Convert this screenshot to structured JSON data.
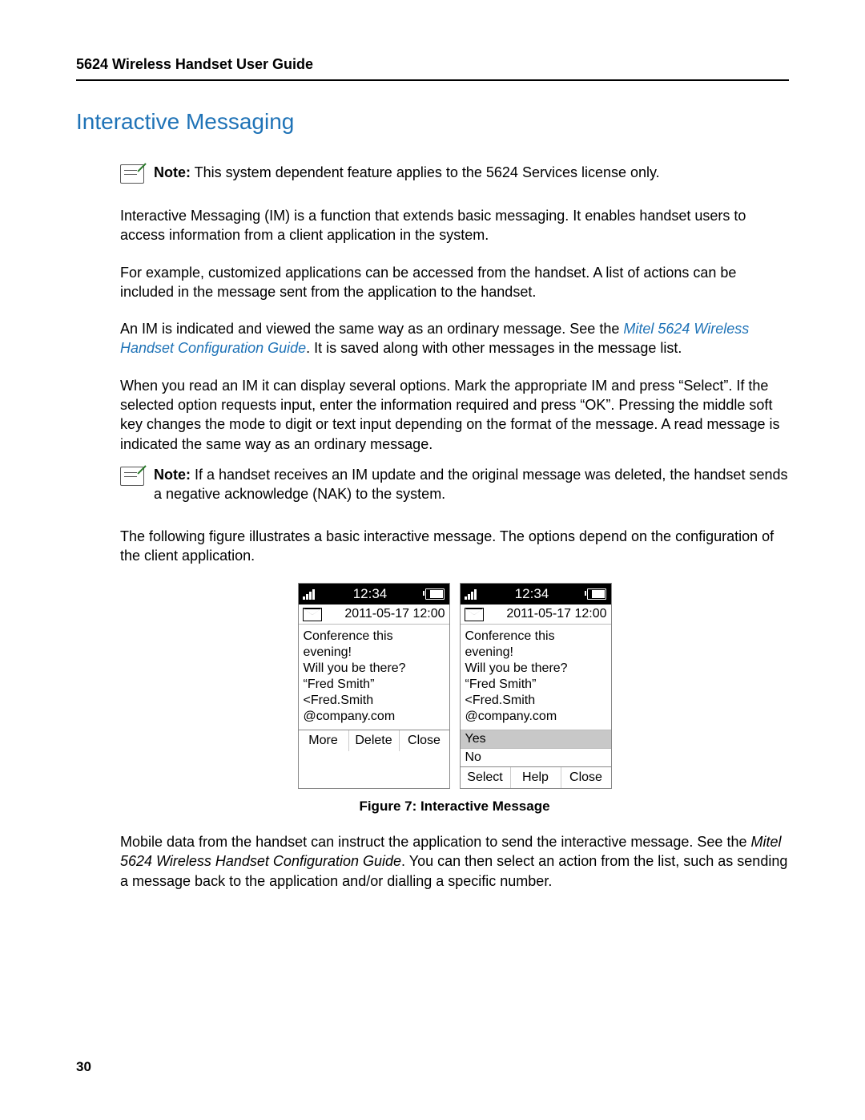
{
  "header": "5624 Wireless Handset User Guide",
  "section_title": "Interactive Messaging",
  "note1": {
    "bold": "Note:",
    "text": " This system dependent feature applies to the 5624 Services license only."
  },
  "para1": "Interactive Messaging (IM) is a function that extends basic messaging. It enables handset users to access information from a client application in the system.",
  "para2": "For example, customized applications can be accessed from the handset. A list of actions can be included in the message sent from the application to the handset.",
  "para3_a": "An IM is indicated and viewed the same way as an ordinary message. See the ",
  "para3_link": "Mitel 5624 Wireless Handset Configuration Guide",
  "para3_b": ". It is saved along with other messages in the message list.",
  "para4": "When you read an IM it can display several options. Mark the appropriate IM and press “Select”. If the selected option requests input, enter the information required and press “OK”. Pressing the middle soft key changes the mode to digit or text input depending on the format of the message. A read message is indicated the same way as an ordinary message.",
  "note2": {
    "bold": "Note:",
    "text": " If a handset receives an IM update and the original message was deleted, the handset sends a negative acknowledge (NAK) to the system."
  },
  "para5": "The following figure illustrates a basic interactive message. The options depend on the configuration of the client application.",
  "figure": {
    "time": "12:34",
    "date": "2011-05-17 12:00",
    "msg_line1": "Conference this evening!",
    "msg_line2": "Will you be there?",
    "msg_line3": "“Fred Smith” <Fred.Smith",
    "msg_line4": "@company.com",
    "left_keys": [
      "More",
      "Delete",
      "Close"
    ],
    "right_options": [
      "Yes",
      "No"
    ],
    "right_keys": [
      "Select",
      "Help",
      "Close"
    ],
    "caption": "Figure 7: Interactive Message"
  },
  "para6_a": "Mobile data from the handset can instruct the application to send the interactive message. See the ",
  "para6_italic": "Mitel 5624 Wireless Handset Configuration Guide",
  "para6_b": ". You can then select an action from the list, such as sending a message back to the application and/or dialling a specific number.",
  "page_number": "30"
}
